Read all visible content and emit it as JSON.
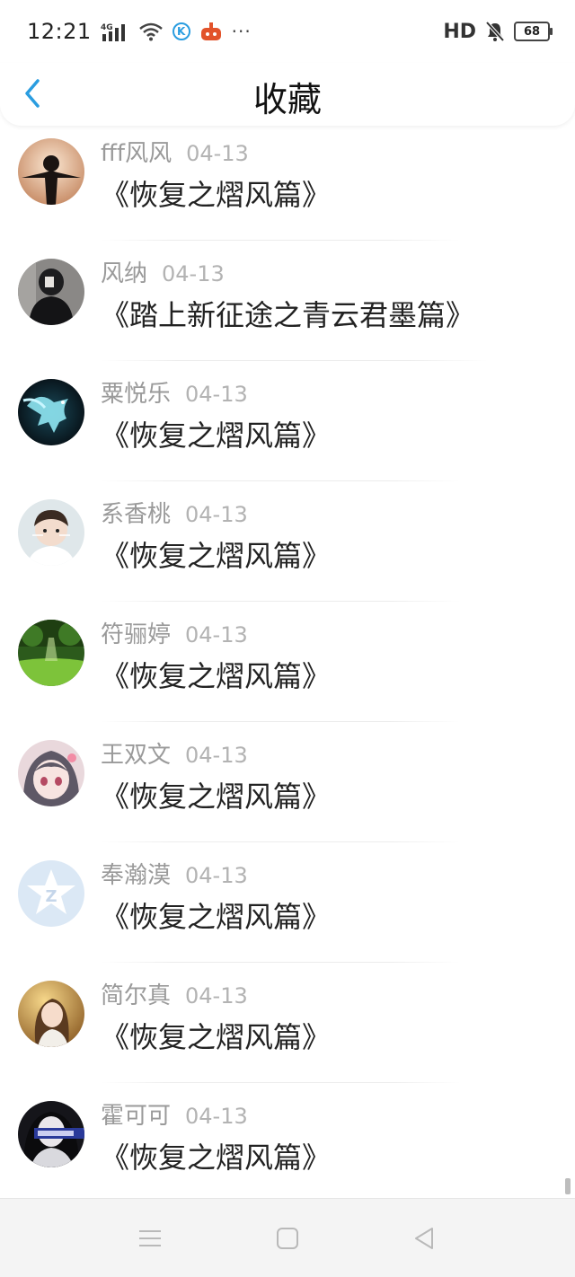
{
  "status_bar": {
    "time": "12:21",
    "network": "4G",
    "dots": "···",
    "hd": "HD",
    "battery": "68",
    "icons": [
      "signal-icon",
      "wifi-icon",
      "k-app-icon",
      "taobao-icon",
      "more-dots-icon",
      "mute-bell-icon",
      "battery-icon"
    ]
  },
  "header": {
    "title": "收藏",
    "back_icon": "chevron-left-icon",
    "accent_color": "#2a9de0"
  },
  "list": {
    "items": [
      {
        "name": "fff风风",
        "date": "04-13",
        "title": "《恢复之熠风篇》"
      },
      {
        "name": "风纳",
        "date": "04-13",
        "title": "《踏上新征途之青云君墨篇》"
      },
      {
        "name": "粟悦乐",
        "date": "04-13",
        "title": "《恢复之熠风篇》"
      },
      {
        "name": "系香桃",
        "date": "04-13",
        "title": "《恢复之熠风篇》"
      },
      {
        "name": "符骊婷",
        "date": "04-13",
        "title": "《恢复之熠风篇》"
      },
      {
        "name": "王双文",
        "date": "04-13",
        "title": "《恢复之熠风篇》"
      },
      {
        "name": "奉瀚漠",
        "date": "04-13",
        "title": "《恢复之熠风篇》"
      },
      {
        "name": "简尔真",
        "date": "04-13",
        "title": "《恢复之熠风篇》"
      },
      {
        "name": "霍可可",
        "date": "04-13",
        "title": "《恢复之熠风篇》"
      }
    ]
  },
  "nav_bar": {
    "icons": [
      "menu-icon",
      "home-square-icon",
      "back-triangle-icon"
    ]
  }
}
